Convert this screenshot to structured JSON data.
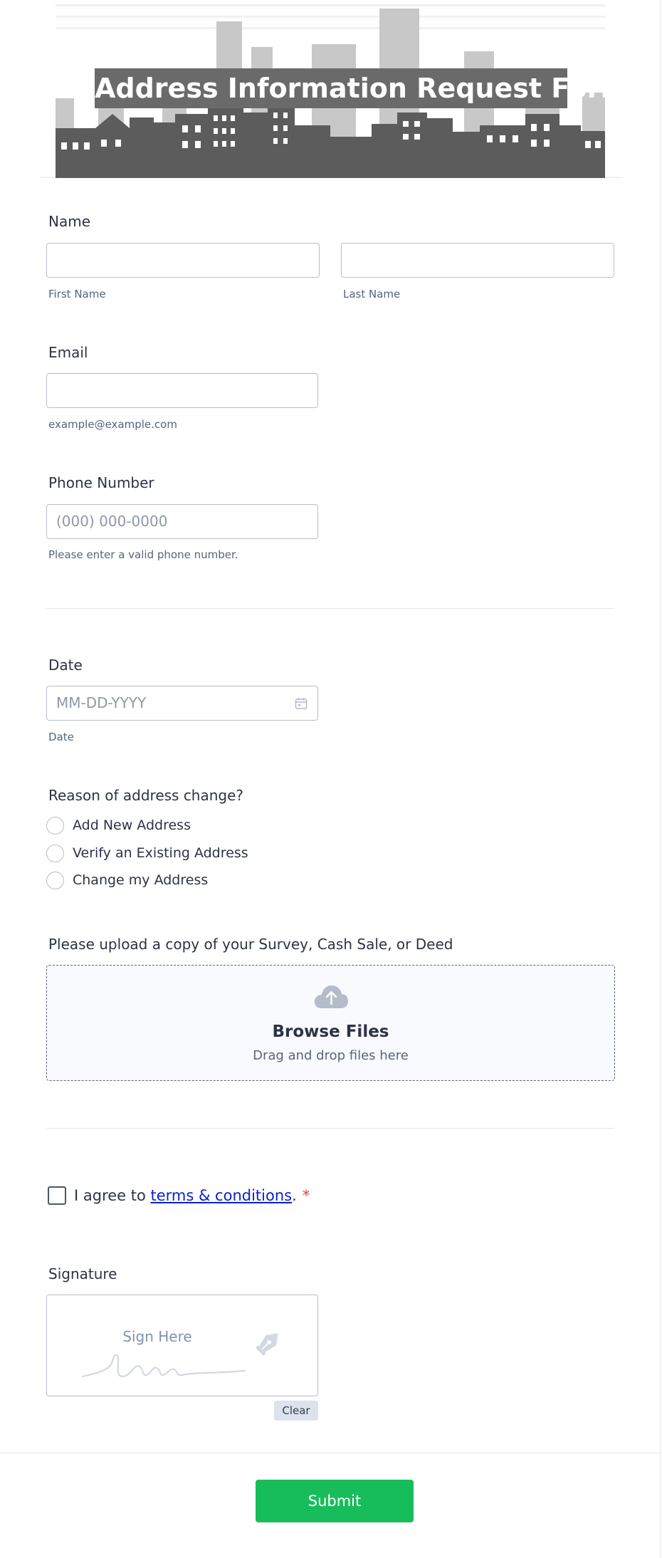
{
  "header": {
    "title": "Address Information Request Form"
  },
  "fields": {
    "name": {
      "label": "Name",
      "first_value": "",
      "last_value": "",
      "first_sublabel": "First Name",
      "last_sublabel": "Last Name"
    },
    "email": {
      "label": "Email",
      "value": "",
      "sublabel": "example@example.com"
    },
    "phone": {
      "label": "Phone Number",
      "placeholder": "(000) 000-0000",
      "sublabel": "Please enter a valid phone number."
    },
    "date": {
      "label": "Date",
      "placeholder": "MM-DD-YYYY",
      "sublabel": "Date",
      "icon": "calendar-icon"
    },
    "reason": {
      "label": "Reason of address change?",
      "options": [
        "Add New Address",
        "Verify an Existing Address",
        "Change my Address"
      ]
    },
    "upload": {
      "label": "Please upload a copy of your Survey, Cash Sale, or Deed",
      "title": "Browse Files",
      "subtitle": "Drag and drop files here",
      "icon": "cloud-upload-icon"
    },
    "terms": {
      "prefix": "I agree to ",
      "link": "terms & conditions",
      "suffix": ".",
      "required_mark": "*"
    },
    "signature": {
      "label": "Signature",
      "placeholder": "Sign Here",
      "clear_label": "Clear",
      "icon": "pen-nib-icon"
    }
  },
  "submit": {
    "label": "Submit"
  },
  "colors": {
    "submit": "#18bd5b",
    "link": "#0a1fcc",
    "required": "#f23a3c",
    "title_bg": "#6a6a6a"
  }
}
